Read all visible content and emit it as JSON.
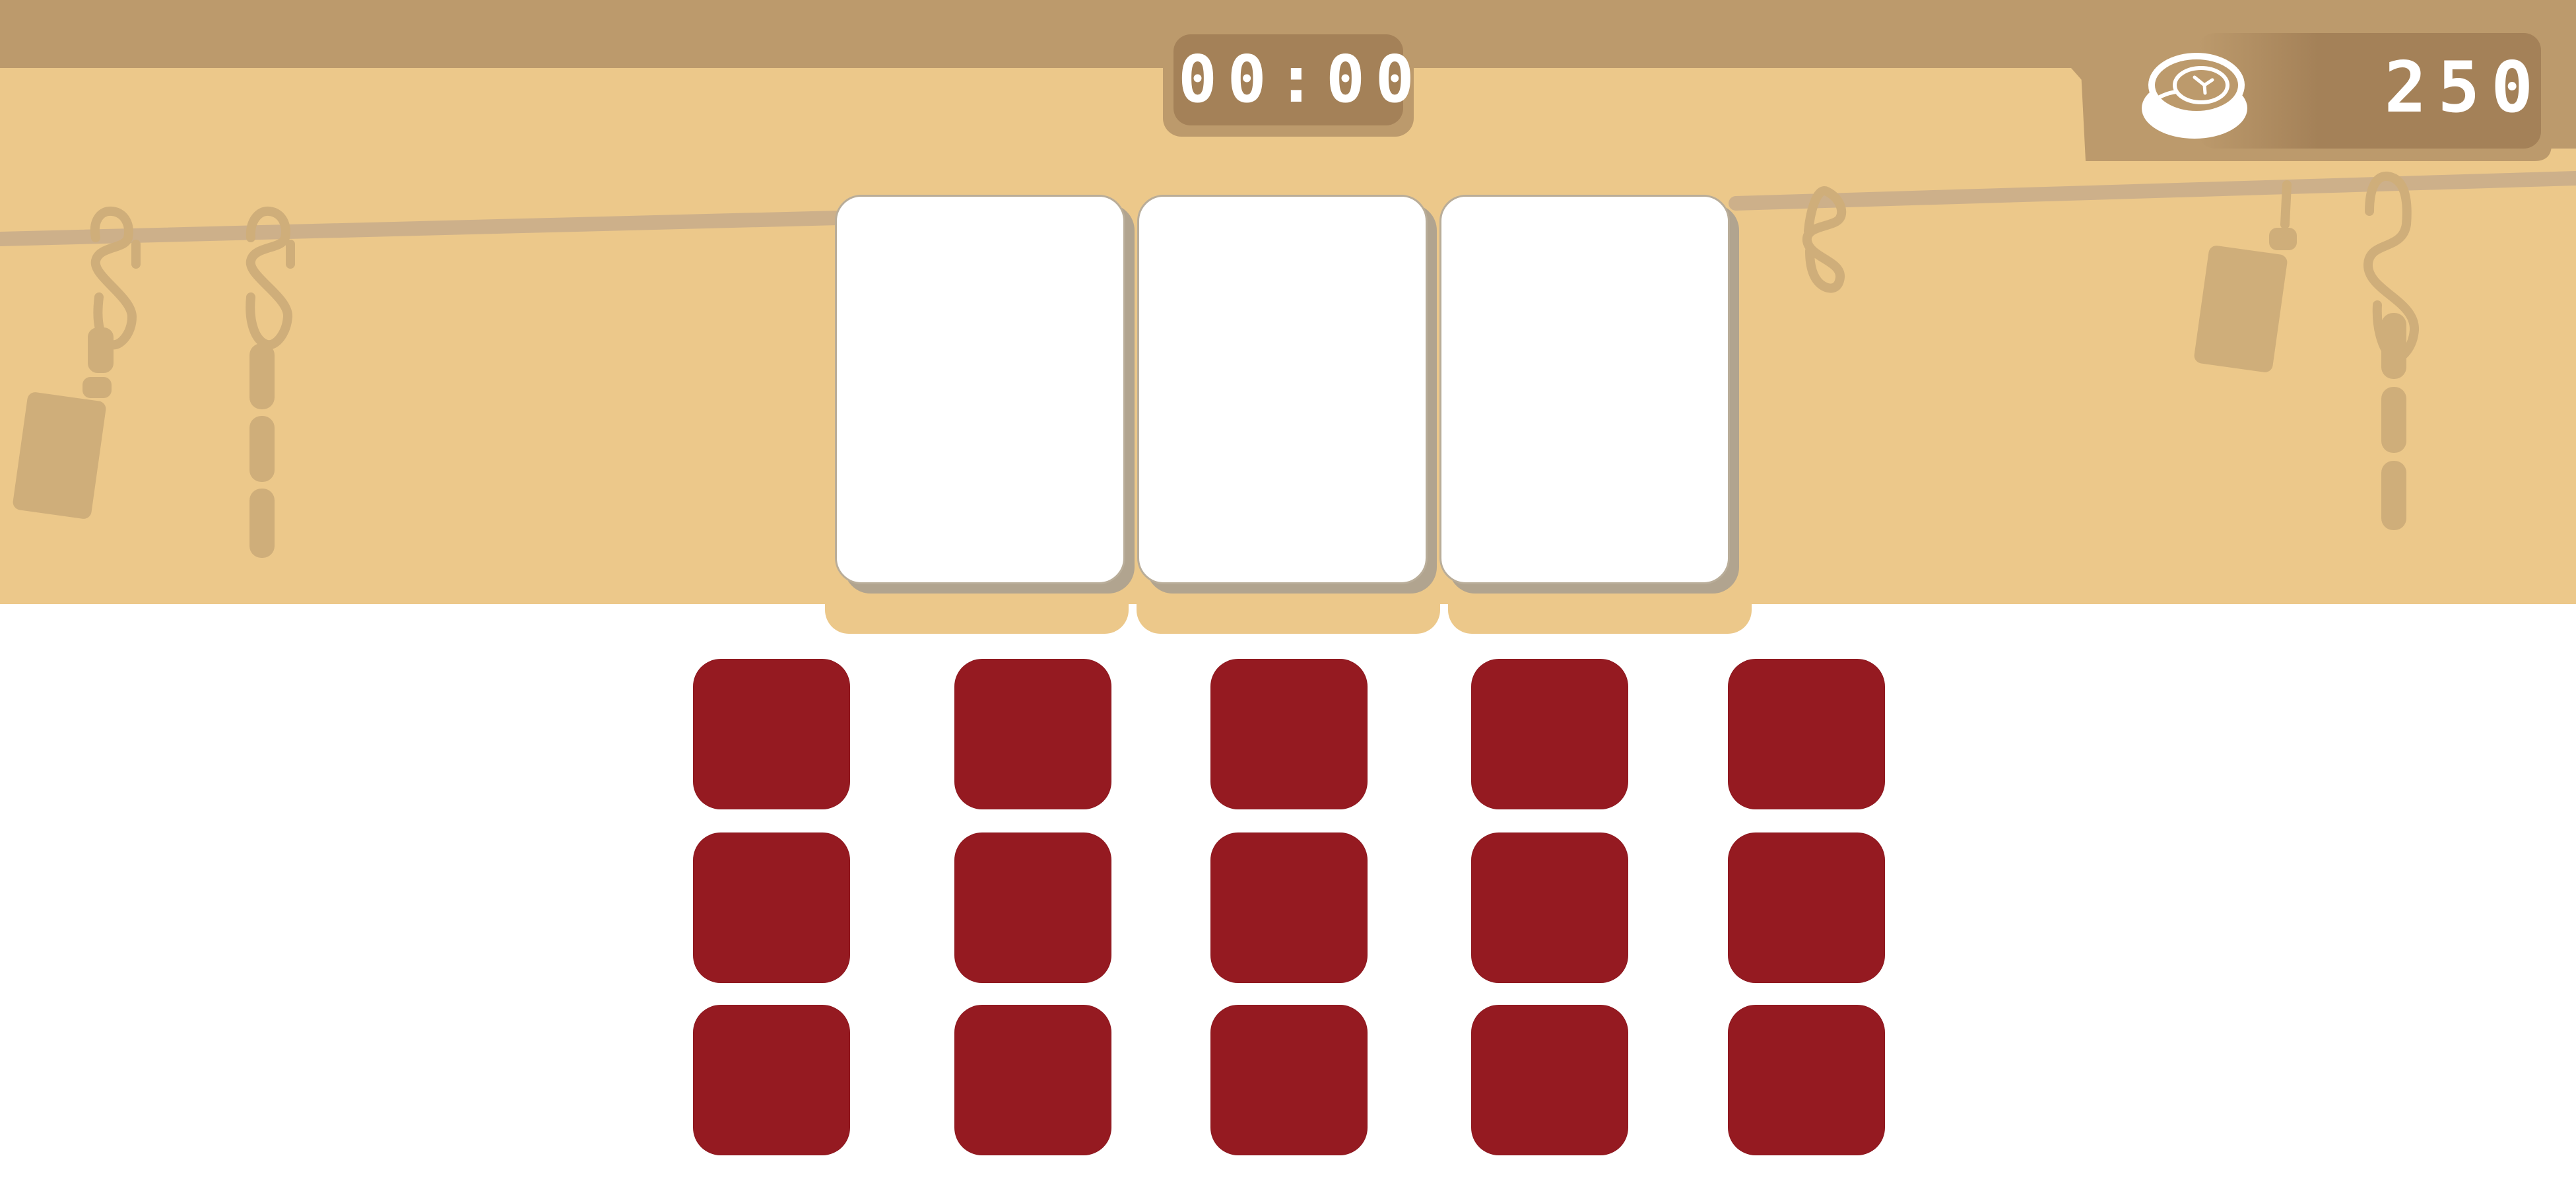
{
  "hud": {
    "timer": "00:00",
    "score": "250",
    "score_icon": "meat-steak-icon"
  },
  "board": {
    "slot_count": 3,
    "tile_rows": 3,
    "tile_columns": 5
  },
  "colors": {
    "top_bar": "#bc9a6c",
    "background_wall": "#ecc88a",
    "hanger_props": "#cfae7a",
    "slot_card": "#ffffff",
    "tile": "#951a21",
    "hud_panel": "#a48158"
  },
  "decor": {
    "left_hooks": [
      "hook-icon",
      "hook-icon"
    ],
    "right_hooks": [
      "hook-icon",
      "hook-icon",
      "hook-icon"
    ]
  }
}
